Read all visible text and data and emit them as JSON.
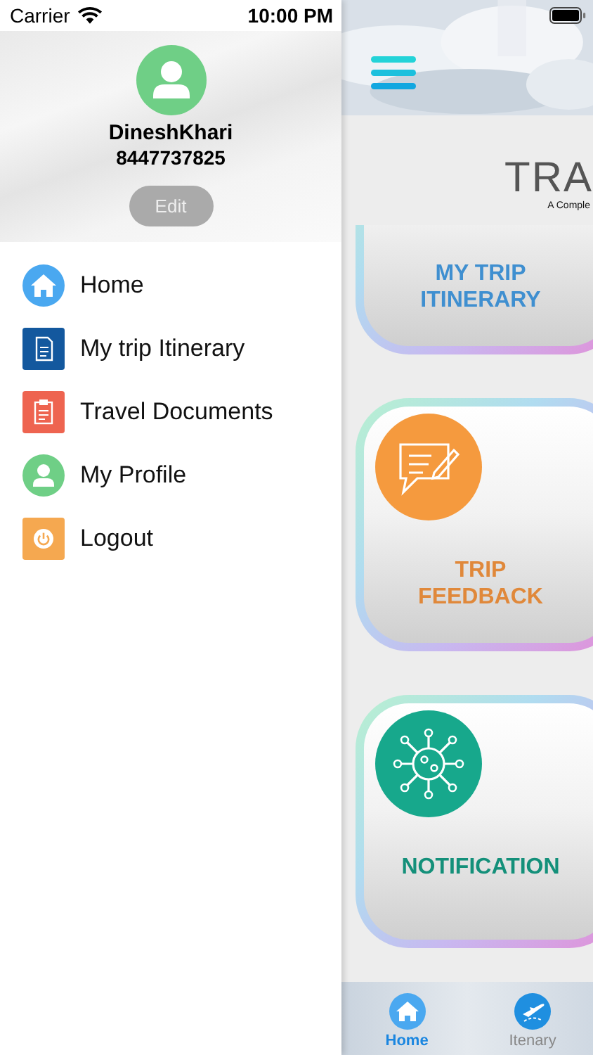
{
  "status_bar": {
    "carrier": "Carrier",
    "time": "10:00 PM"
  },
  "drawer": {
    "profile": {
      "name": "DineshKhari",
      "phone": "8447737825",
      "edit_button": "Edit"
    },
    "menu": [
      {
        "label": "Home"
      },
      {
        "label": "My trip Itinerary"
      },
      {
        "label": "Travel Documents"
      },
      {
        "label": "My Profile"
      },
      {
        "label": "Logout"
      }
    ]
  },
  "main": {
    "logo": {
      "title": "TRA",
      "subtitle": "A Comple"
    },
    "cards": [
      {
        "label": "MY TRIP\nITINERARY",
        "color": "#3f8fd0"
      },
      {
        "label": "TRIP\nFEEDBACK",
        "color": "#e0883a"
      },
      {
        "label": "NOTIFICATION",
        "color": "#14907a"
      }
    ]
  },
  "tab_bar": {
    "tabs": [
      {
        "label": "Home",
        "selected": true
      },
      {
        "label": "Itenary",
        "selected": false
      }
    ]
  }
}
